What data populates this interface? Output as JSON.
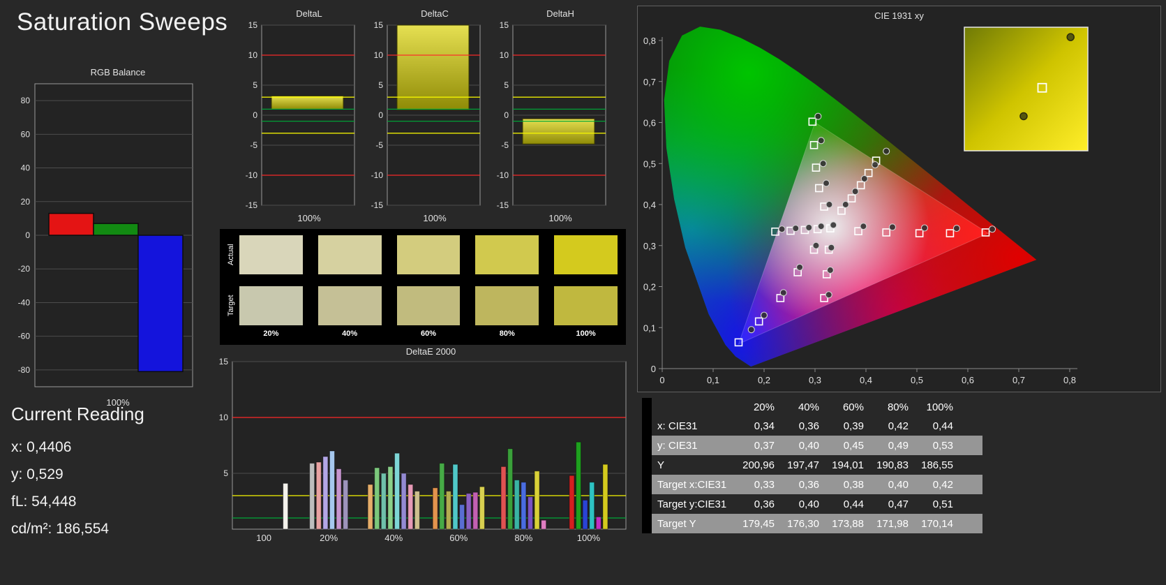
{
  "title": "Saturation Sweeps",
  "current_reading": {
    "heading": "Current Reading",
    "lines": [
      "x: 0,4406",
      "y: 0,529",
      "fL: 54,448",
      "cd/m²: 186,554"
    ]
  },
  "swatches": {
    "row_labels": [
      "Actual",
      "Target"
    ],
    "col_labels": [
      "20%",
      "40%",
      "60%",
      "80%",
      "100%"
    ],
    "actual_colors": [
      "#d9d6ba",
      "#d6d1a0",
      "#d3cc7e",
      "#d1c94e",
      "#d4ca1e"
    ],
    "target_colors": [
      "#c8c8ae",
      "#c5c096",
      "#c1bb7e",
      "#beb65e",
      "#c0b83f"
    ]
  },
  "table": {
    "corner_label": "",
    "col_headers": [
      "20%",
      "40%",
      "60%",
      "80%",
      "100%"
    ],
    "rows": [
      {
        "label": "x: CIE31",
        "values": [
          "0,34",
          "0,36",
          "0,39",
          "0,42",
          "0,44"
        ]
      },
      {
        "label": "y: CIE31",
        "values": [
          "0,37",
          "0,40",
          "0,45",
          "0,49",
          "0,53"
        ]
      },
      {
        "label": "Y",
        "values": [
          "200,96",
          "197,47",
          "194,01",
          "190,83",
          "186,55"
        ]
      },
      {
        "label": "Target x:CIE31",
        "values": [
          "0,33",
          "0,36",
          "0,38",
          "0,40",
          "0,42"
        ]
      },
      {
        "label": "Target y:CIE31",
        "values": [
          "0,36",
          "0,40",
          "0,44",
          "0,47",
          "0,51"
        ]
      },
      {
        "label": "Target Y",
        "values": [
          "179,45",
          "176,30",
          "173,88",
          "171,98",
          "170,14"
        ]
      }
    ]
  },
  "chart_data": [
    {
      "id": "rgb-balance",
      "type": "bar",
      "title": "RGB Balance",
      "categories": [
        "Red",
        "Green",
        "Blue"
      ],
      "values": [
        13,
        7,
        -81
      ],
      "colors": [
        "#e41414",
        "#128a12",
        "#1414dc"
      ],
      "ylim": [
        -90,
        90
      ],
      "yticks": [
        80,
        60,
        40,
        20,
        0,
        -20,
        -40,
        -60,
        -80
      ],
      "xlabel": "100%"
    },
    {
      "id": "deltaL",
      "type": "floating-bar",
      "title": "DeltaL",
      "low": 1.0,
      "high": 3.2,
      "ylim": [
        -15,
        15
      ],
      "yticks": [
        15,
        10,
        5,
        0,
        -5,
        -10,
        -15
      ],
      "ref_lines": [
        {
          "value": 10,
          "color": "#ff2828"
        },
        {
          "value": -10,
          "color": "#ff2828"
        },
        {
          "value": 3,
          "color": "#f8f800"
        },
        {
          "value": -3,
          "color": "#f8f800"
        },
        {
          "value": 1,
          "color": "#00a838"
        },
        {
          "value": -1,
          "color": "#00a838"
        }
      ],
      "xlabel": "100%"
    },
    {
      "id": "deltaC",
      "type": "floating-bar",
      "title": "DeltaC",
      "low": 0.9,
      "high": 15,
      "ylim": [
        -15,
        15
      ],
      "yticks": [
        15,
        10,
        5,
        0,
        -5,
        -10,
        -15
      ],
      "ref_lines": [
        {
          "value": 10,
          "color": "#ff2828"
        },
        {
          "value": -10,
          "color": "#ff2828"
        },
        {
          "value": 3,
          "color": "#f8f800"
        },
        {
          "value": -3,
          "color": "#f8f800"
        },
        {
          "value": 1,
          "color": "#00a838"
        },
        {
          "value": -1,
          "color": "#00a838"
        }
      ],
      "xlabel": "100%"
    },
    {
      "id": "deltaH",
      "type": "floating-bar",
      "title": "DeltaH",
      "low": -4.8,
      "high": -0.6,
      "ylim": [
        -15,
        15
      ],
      "yticks": [
        15,
        10,
        5,
        0,
        -5,
        -10,
        -15
      ],
      "ref_lines": [
        {
          "value": 10,
          "color": "#ff2828"
        },
        {
          "value": -10,
          "color": "#ff2828"
        },
        {
          "value": 3,
          "color": "#f8f800"
        },
        {
          "value": -3,
          "color": "#f8f800"
        },
        {
          "value": 1,
          "color": "#00a838"
        },
        {
          "value": -1,
          "color": "#00a838"
        }
      ],
      "xlabel": "100%"
    },
    {
      "id": "deltaE-2000",
      "type": "bar-groups",
      "title": "DeltaE 2000",
      "ylim": [
        0,
        15
      ],
      "yticks": [
        15,
        10,
        5
      ],
      "ref_lines": [
        {
          "value": 10,
          "color": "#ff2828"
        },
        {
          "value": 3,
          "color": "#f8f800"
        },
        {
          "value": 1,
          "color": "#00a838"
        }
      ],
      "groups": [
        {
          "label": "100",
          "label_pos": 0.08,
          "center": 0.135,
          "bars": [
            {
              "value": 4.1,
              "color": "#f4f2ec"
            }
          ]
        },
        {
          "label": "20%",
          "label_pos": 0.245,
          "center": 0.245,
          "bars": [
            {
              "value": 5.9,
              "color": "#bdbdbd"
            },
            {
              "value": 6.0,
              "color": "#e8a2a2"
            },
            {
              "value": 6.5,
              "color": "#b3a6e6"
            },
            {
              "value": 7.0,
              "color": "#a6c8ee"
            },
            {
              "value": 5.4,
              "color": "#c695ce"
            },
            {
              "value": 4.4,
              "color": "#9d93bb"
            }
          ]
        },
        {
          "label": "40%",
          "label_pos": 0.41,
          "center": 0.41,
          "bars": [
            {
              "value": 4.0,
              "color": "#e6ae6a"
            },
            {
              "value": 5.5,
              "color": "#7cc87c"
            },
            {
              "value": 5.0,
              "color": "#6fc0ab"
            },
            {
              "value": 5.6,
              "color": "#8ad08a"
            },
            {
              "value": 6.8,
              "color": "#7ed6d6"
            },
            {
              "value": 5.0,
              "color": "#948ad2"
            },
            {
              "value": 4.0,
              "color": "#e69ab6"
            },
            {
              "value": 3.4,
              "color": "#cdbf8e"
            }
          ]
        },
        {
          "label": "60%",
          "label_pos": 0.575,
          "center": 0.575,
          "bars": [
            {
              "value": 3.7,
              "color": "#e2944e"
            },
            {
              "value": 5.9,
              "color": "#46aa46"
            },
            {
              "value": 3.4,
              "color": "#b2ab50"
            },
            {
              "value": 5.8,
              "color": "#50c8c8"
            },
            {
              "value": 2.2,
              "color": "#5a6ed2"
            },
            {
              "value": 3.2,
              "color": "#8a60c0"
            },
            {
              "value": 3.3,
              "color": "#c260b2"
            },
            {
              "value": 3.8,
              "color": "#d8d050"
            }
          ]
        },
        {
          "label": "80%",
          "label_pos": 0.74,
          "center": 0.74,
          "bars": [
            {
              "value": 5.6,
              "color": "#e05252"
            },
            {
              "value": 7.2,
              "color": "#3aa03a"
            },
            {
              "value": 4.4,
              "color": "#3ab4a4"
            },
            {
              "value": 4.2,
              "color": "#4a6ce0"
            },
            {
              "value": 2.9,
              "color": "#7a52c2"
            },
            {
              "value": 5.2,
              "color": "#d8d038"
            },
            {
              "value": 0.8,
              "color": "#e07ec2"
            }
          ]
        },
        {
          "label": "100%",
          "label_pos": 0.905,
          "center": 0.905,
          "bars": [
            {
              "value": 4.8,
              "color": "#d42020"
            },
            {
              "value": 7.8,
              "color": "#1ea01e"
            },
            {
              "value": 2.6,
              "color": "#2a44d4"
            },
            {
              "value": 4.2,
              "color": "#2ec2c2"
            },
            {
              "value": 1.1,
              "color": "#c22ec2"
            },
            {
              "value": 5.8,
              "color": "#d4ca1e"
            }
          ]
        }
      ]
    },
    {
      "id": "cie-1931",
      "type": "scatter",
      "title": "CIE 1931 xy",
      "xlim": [
        0,
        0.8
      ],
      "ylim": [
        0,
        0.8
      ],
      "xtick_labels": [
        "0",
        "0,1",
        "0,2",
        "0,3",
        "0,4",
        "0,5",
        "0,6",
        "0,7",
        "0,8"
      ],
      "ytick_labels": [
        "0",
        "0,1",
        "0,2",
        "0,3",
        "0,4",
        "0,5",
        "0,6",
        "0,7",
        "0,8"
      ],
      "targets": [
        [
          0.33,
          0.342
        ],
        [
          0.385,
          0.335
        ],
        [
          0.44,
          0.332
        ],
        [
          0.505,
          0.33
        ],
        [
          0.565,
          0.33
        ],
        [
          0.635,
          0.332
        ],
        [
          0.318,
          0.395
        ],
        [
          0.308,
          0.44
        ],
        [
          0.302,
          0.49
        ],
        [
          0.298,
          0.545
        ],
        [
          0.295,
          0.602
        ],
        [
          0.352,
          0.385
        ],
        [
          0.372,
          0.415
        ],
        [
          0.39,
          0.447
        ],
        [
          0.405,
          0.477
        ],
        [
          0.42,
          0.507
        ],
        [
          0.305,
          0.34
        ],
        [
          0.28,
          0.338
        ],
        [
          0.252,
          0.336
        ],
        [
          0.222,
          0.334
        ],
        [
          0.327,
          0.29
        ],
        [
          0.323,
          0.23
        ],
        [
          0.318,
          0.172
        ],
        [
          0.298,
          0.29
        ],
        [
          0.266,
          0.235
        ],
        [
          0.232,
          0.172
        ],
        [
          0.19,
          0.115
        ],
        [
          0.15,
          0.064
        ]
      ],
      "measurements": [
        [
          0.336,
          0.35
        ],
        [
          0.395,
          0.347
        ],
        [
          0.452,
          0.345
        ],
        [
          0.515,
          0.343
        ],
        [
          0.578,
          0.342
        ],
        [
          0.648,
          0.34
        ],
        [
          0.328,
          0.4
        ],
        [
          0.322,
          0.452
        ],
        [
          0.316,
          0.5
        ],
        [
          0.312,
          0.556
        ],
        [
          0.306,
          0.615
        ],
        [
          0.36,
          0.4
        ],
        [
          0.379,
          0.432
        ],
        [
          0.397,
          0.463
        ],
        [
          0.418,
          0.497
        ],
        [
          0.44,
          0.53
        ],
        [
          0.312,
          0.347
        ],
        [
          0.288,
          0.344
        ],
        [
          0.262,
          0.342
        ],
        [
          0.235,
          0.34
        ],
        [
          0.332,
          0.295
        ],
        [
          0.33,
          0.24
        ],
        [
          0.327,
          0.18
        ],
        [
          0.302,
          0.3
        ],
        [
          0.27,
          0.247
        ],
        [
          0.238,
          0.185
        ],
        [
          0.2,
          0.13
        ],
        [
          0.175,
          0.095
        ]
      ],
      "inset": {
        "square": [
          0.63,
          0.49
        ],
        "circles": [
          [
            0.48,
            0.72
          ],
          [
            0.86,
            0.08
          ]
        ]
      }
    }
  ]
}
